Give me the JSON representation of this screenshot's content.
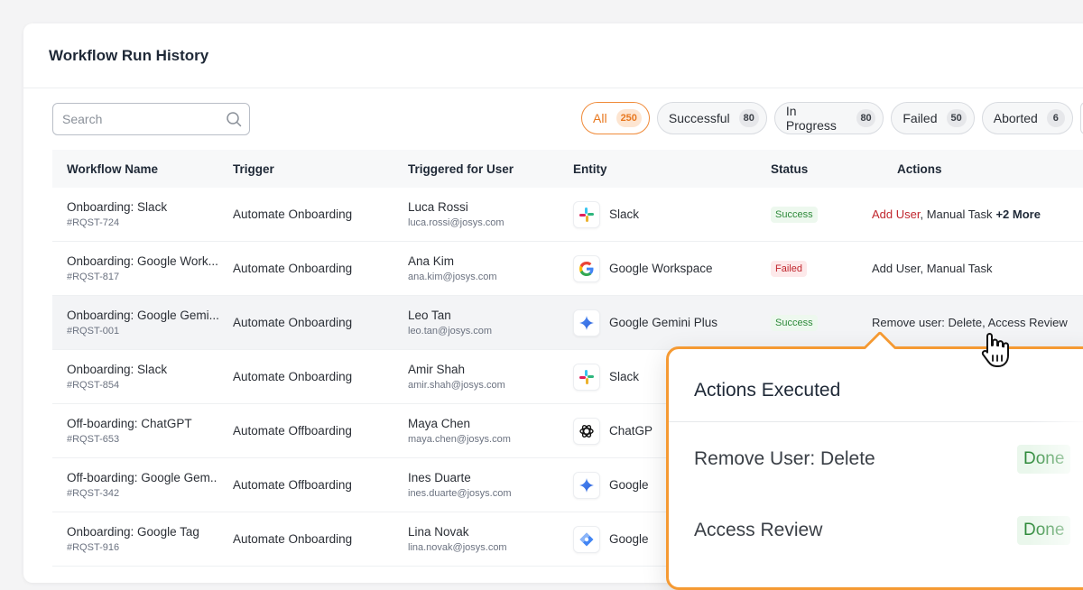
{
  "panel": {
    "title": "Workflow Run History"
  },
  "search": {
    "placeholder": "Search",
    "icon": "search-icon"
  },
  "filters": [
    {
      "label": "All",
      "count": "250",
      "active": true
    },
    {
      "label": "Successful",
      "count": "80"
    },
    {
      "label": "In Progress",
      "count": "80"
    },
    {
      "label": "Failed",
      "count": "50"
    },
    {
      "label": "Aborted",
      "count": "6"
    }
  ],
  "table": {
    "headers": {
      "name": "Workflow Name",
      "trigger": "Trigger",
      "user": "Triggered for User",
      "entity": "Entity",
      "status": "Status",
      "actions": "Actions"
    },
    "rows": [
      {
        "name": "Onboarding: Slack",
        "id": "#RQST-724",
        "trigger": "Automate Onboarding",
        "user": "Luca Rossi",
        "email": "luca.rossi@josys.com",
        "entity": "Slack",
        "entity_icon": "slack-icon",
        "status": "Success",
        "status_kind": "success",
        "actions_red": "Add User",
        "actions": ", Manual Task",
        "actions_more": "+2 More"
      },
      {
        "name": "Onboarding: Google Work...",
        "id": "#RQST-817",
        "trigger": "Automate Onboarding",
        "user": "Ana Kim",
        "email": "ana.kim@josys.com",
        "entity": "Google Workspace",
        "entity_icon": "google-icon",
        "status": "Failed",
        "status_kind": "failed",
        "actions_red": "",
        "actions": "Add User, Manual Task",
        "actions_more": ""
      },
      {
        "name": "Onboarding: Google Gemi...",
        "id": "#RQST-001",
        "trigger": "Automate Onboarding",
        "user": "Leo Tan",
        "email": "leo.tan@josys.com",
        "entity": "Google Gemini Plus",
        "entity_icon": "gemini-icon",
        "status": "Success",
        "status_kind": "success",
        "actions_red": "",
        "actions": "Remove user: Delete, Access Review",
        "actions_more": ""
      },
      {
        "name": "Onboarding: Slack",
        "id": "#RQST-854",
        "trigger": "Automate Onboarding",
        "user": "Amir Shah",
        "email": "amir.shah@josys.com",
        "entity": "Slack",
        "entity_icon": "slack-icon",
        "status": "",
        "status_kind": "",
        "actions_red": "",
        "actions": "",
        "actions_more": ""
      },
      {
        "name": "Off-boarding: ChatGPT",
        "id": "#RQST-653",
        "trigger": "Automate Offboarding",
        "user": "Maya Chen",
        "email": "maya.chen@josys.com",
        "entity": "ChatGP",
        "entity_icon": "chatgpt-icon",
        "status": "",
        "status_kind": "",
        "actions_red": "",
        "actions": "",
        "actions_more": ""
      },
      {
        "name": "Off-boarding: Google Gem..",
        "id": "#RQST-342",
        "trigger": "Automate Offboarding",
        "user": "Ines Duarte",
        "email": "ines.duarte@josys.com",
        "entity": "Google",
        "entity_icon": "gemini-icon",
        "status": "",
        "status_kind": "",
        "actions_red": "",
        "actions": "",
        "actions_more": ""
      },
      {
        "name": "Onboarding: Google Tag",
        "id": "#RQST-916",
        "trigger": "Automate Onboarding",
        "user": "Lina Novak",
        "email": "lina.novak@josys.com",
        "entity": "Google",
        "entity_icon": "google-tag-icon",
        "status": "",
        "status_kind": "",
        "actions_red": "",
        "actions": "",
        "actions_more": ""
      }
    ]
  },
  "popover": {
    "title": "Actions Executed",
    "items": [
      {
        "label": "Remove User: Delete",
        "state": "Done"
      },
      {
        "label": "Access Review",
        "state": "Done"
      }
    ]
  },
  "colors": {
    "accent": "#f59a33",
    "success": "#2e8a3a",
    "failed": "#c0262d"
  }
}
